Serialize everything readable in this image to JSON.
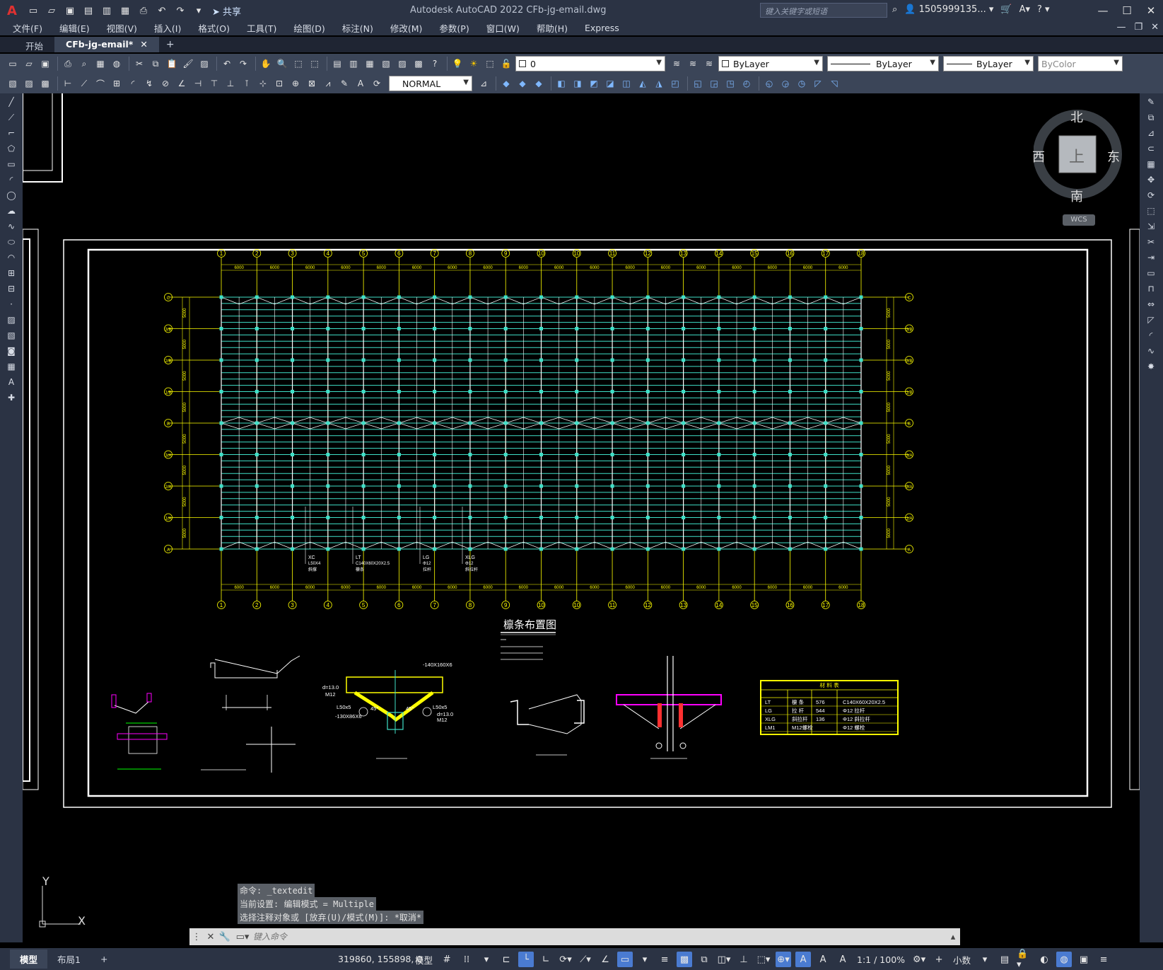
{
  "app": {
    "logo": "A",
    "title": "Autodesk AutoCAD 2022    CFb-jg-email.dwg",
    "share": "共享",
    "search_placeholder": "键入关键字或短语",
    "user": "1505999135..."
  },
  "menu": [
    "文件(F)",
    "编辑(E)",
    "视图(V)",
    "插入(I)",
    "格式(O)",
    "工具(T)",
    "绘图(D)",
    "标注(N)",
    "修改(M)",
    "参数(P)",
    "窗口(W)",
    "帮助(H)",
    "Express"
  ],
  "tabs": [
    {
      "label": "开始",
      "active": false
    },
    {
      "label": "CFb-jg-email*",
      "active": true
    }
  ],
  "toolbar": {
    "layer_value": "0",
    "color": "ByLayer",
    "linetype": "ByLayer",
    "lineweight": "ByLayer",
    "plotstyle": "ByColor",
    "dimstyle": "NORMAL"
  },
  "viewcube": {
    "north": "北",
    "south": "南",
    "east": "东",
    "west": "西",
    "face": "上",
    "wcs": "WCS"
  },
  "drawing": {
    "title": "檩条布置图",
    "grid_cols": [
      "1",
      "2",
      "3",
      "4",
      "5",
      "6",
      "7",
      "8",
      "9",
      "10",
      "10",
      "11",
      "12",
      "13",
      "14",
      "15",
      "16",
      "17",
      "18"
    ],
    "grid_rows": [
      "C",
      "3/B",
      "2/B",
      "1/B",
      "B",
      "3/A",
      "2/A",
      "1/A",
      "A"
    ],
    "bay_dim": "6000",
    "row_dim": "5000",
    "members": [
      {
        "code": "XC",
        "spec": "L50X4",
        "name": "斜撑"
      },
      {
        "code": "LT",
        "spec": "C140X60X20X2.5",
        "name": "檩条"
      },
      {
        "code": "LG",
        "spec": "Φ12",
        "name": "拉杆"
      },
      {
        "code": "XLG",
        "spec": "Φ12",
        "name": "斜拉杆"
      }
    ],
    "schedule_title": "材 料 表",
    "schedule_rows": [
      [
        "LT",
        "檩 条",
        "576",
        "C140X60X20X2.5"
      ],
      [
        "LG",
        "拉 杆",
        "544",
        "Φ12 拉杆"
      ],
      [
        "XLG",
        "斜拉杆",
        "136",
        "Φ12 斜拉杆"
      ],
      [
        "LM1",
        "M12螺栓",
        "",
        "Φ12 螺栓"
      ]
    ],
    "detail_labels": [
      "L50x5",
      "L50x5",
      "-130X86X6",
      "-140X160X6",
      "M12",
      "M12",
      "d=13.0",
      "d=13.0",
      "45°",
      "45°"
    ]
  },
  "command": {
    "history": [
      "命令: _textedit",
      "当前设置: 编辑模式 = Multiple",
      "选择注释对象或 [放弃(U)/模式(M)]: *取消*"
    ],
    "placeholder": "键入命令"
  },
  "ucs": {
    "x": "X",
    "y": "Y"
  },
  "status": {
    "layout_tabs": [
      "模型",
      "布局1"
    ],
    "coords": "319860, 155898, 0",
    "space": "模型",
    "scale": "1:1 / 100%",
    "units": "小数"
  }
}
